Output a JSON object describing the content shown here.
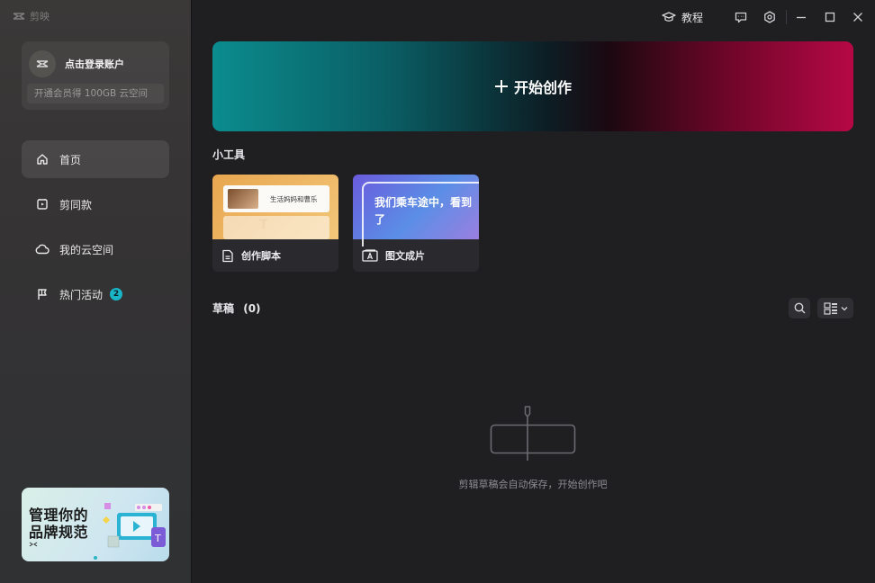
{
  "app": {
    "name": "剪映"
  },
  "account": {
    "login_text": "点击登录账户",
    "member_promo": "开通会员得 100GB 云空间"
  },
  "nav": [
    {
      "label": "首页",
      "icon": "home-icon",
      "active": true
    },
    {
      "label": "剪同款",
      "icon": "template-icon",
      "active": false
    },
    {
      "label": "我的云空间",
      "icon": "cloud-icon",
      "active": false
    },
    {
      "label": "热门活动",
      "icon": "flag-icon",
      "active": false,
      "badge": "2"
    }
  ],
  "promo": {
    "line1": "管理你的",
    "line2": "品牌规范"
  },
  "titlebar": {
    "tutorial": "教程",
    "icons": [
      "feedback-icon",
      "settings-icon",
      "minimize-icon",
      "maximize-icon",
      "close-icon"
    ]
  },
  "hero": {
    "label": "开始创作"
  },
  "tools": {
    "title": "小工具",
    "items": [
      {
        "label": "创作脚本",
        "thumb_text": "生活妈妈和曹乐",
        "icon": "script-icon"
      },
      {
        "label": "图文成片",
        "thumb_text": "我们乘车途中，看到了",
        "icon": "text-to-video-icon"
      }
    ]
  },
  "drafts": {
    "title": "草稿",
    "count": "(0)",
    "empty_text": "剪辑草稿会自动保存，开始创作吧"
  },
  "colors": {
    "accent": "#19b4c6",
    "hero_left": "#0b8c8e",
    "hero_right": "#b60845",
    "background": "#1f1f22"
  }
}
